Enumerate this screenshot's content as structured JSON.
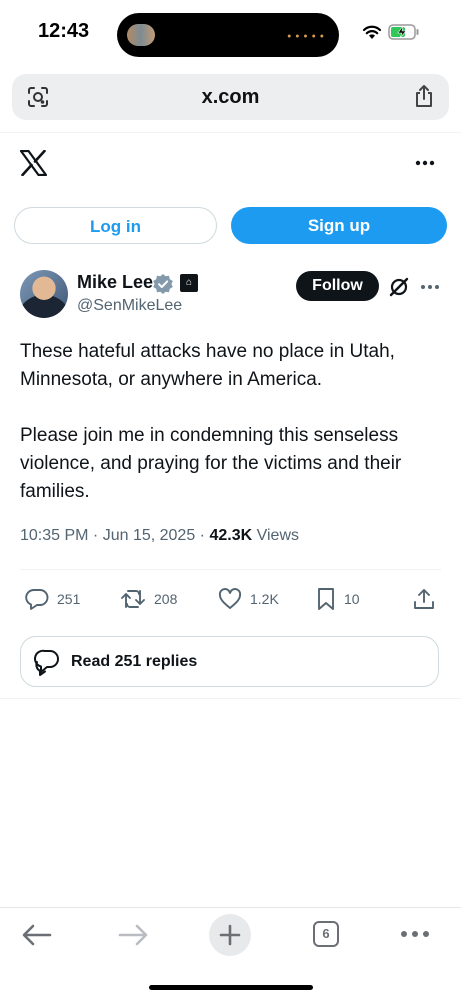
{
  "status_bar": {
    "time": "12:43"
  },
  "browser": {
    "url": "x.com",
    "open_tabs": "6"
  },
  "auth": {
    "login_label": "Log in",
    "signup_label": "Sign up"
  },
  "post": {
    "author": {
      "name": "Mike Lee",
      "handle": "@SenMikeLee"
    },
    "follow_label": "Follow",
    "paragraphs": [
      "These hateful attacks have no place in Utah, Minnesota, or anywhere in America.",
      "Please join me in condemning this senseless violence, and praying for the victims and their families."
    ],
    "timestamp": "10:35 PM · Jun 15, 2025 · ",
    "views_count": "42.3K",
    "views_label": " Views",
    "stats": {
      "replies": "251",
      "reposts": "208",
      "likes": "1.2K",
      "bookmarks": "10"
    },
    "read_replies_label": "Read 251 replies"
  },
  "colors": {
    "accent": "#1d9bf0",
    "text": "#0f1419",
    "muted": "#536471",
    "border": "#cfd9de"
  },
  "icons": [
    "wifi-icon",
    "battery-icon",
    "lens-icon",
    "share-icon",
    "x-logo-icon",
    "more-icon",
    "verified-icon",
    "government-badge-icon",
    "grok-icon",
    "reply-icon",
    "repost-icon",
    "like-icon",
    "bookmark-icon",
    "chat-bubbles-icon",
    "back-arrow-icon",
    "forward-arrow-icon",
    "plus-icon",
    "tabs-icon"
  ]
}
